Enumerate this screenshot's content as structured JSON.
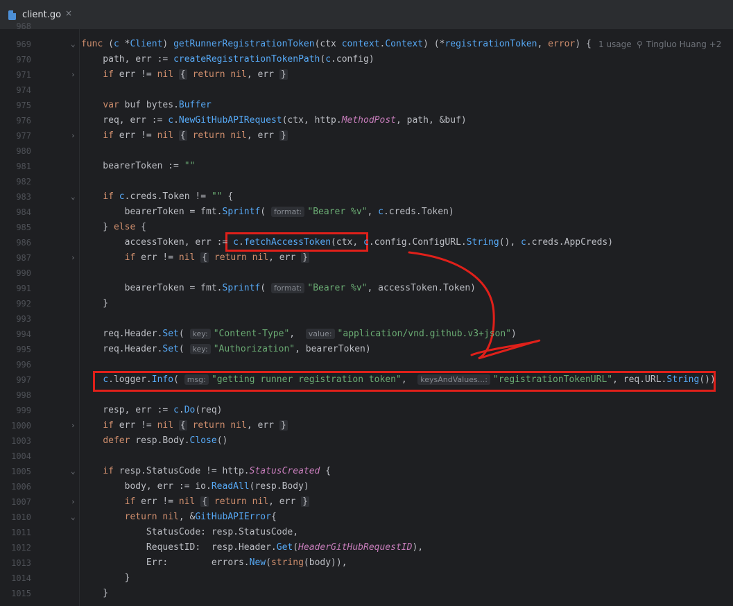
{
  "tab": {
    "filename": "client.go",
    "close_glyph": "×"
  },
  "header_hints": {
    "usages": "1 usage",
    "author": "Tingluo Huang +2"
  },
  "colors": {
    "highlight_box": "#e0201a",
    "keyword": "#cf8e6d",
    "string": "#6aab73",
    "function": "#56a8f5"
  },
  "lines": [
    {
      "n": "969",
      "fold": "v",
      "html": "<span class=\"kw\">func</span> (<span class=\"rc\">c</span> *<span class=\"ty\">Client</span>) <span class=\"fn\">getRunnerRegistrationToken</span>(ctx <span class=\"ty\">context</span>.<span class=\"ty\">Context</span>) (*<span class=\"ty\">registrationToken</span>, <span class=\"kw\">error</span>) {"
    },
    {
      "n": "970",
      "fold": "",
      "html": "    path, err := <span class=\"mt\">createRegistrationTokenPath</span>(<span class=\"rc\">c</span>.config)"
    },
    {
      "n": "971",
      "fold": ">",
      "html": "    <span class=\"kw\">if</span> err != <span class=\"kw\">nil</span> <span class=\"collapsed\">{</span> <span class=\"kw\">return</span> <span class=\"kw\">nil</span>, err <span class=\"collapsed\">}</span>"
    },
    {
      "n": "974",
      "fold": "",
      "html": ""
    },
    {
      "n": "975",
      "fold": "",
      "html": "    <span class=\"kw\">var</span> buf bytes.<span class=\"ty\">Buffer</span>"
    },
    {
      "n": "976",
      "fold": "",
      "html": "    req, err := <span class=\"rc\">c</span>.<span class=\"mt\">NewGitHubAPIRequest</span>(ctx, http.<span class=\"it\">MethodPost</span>, path, &amp;buf)"
    },
    {
      "n": "977",
      "fold": ">",
      "html": "    <span class=\"kw\">if</span> err != <span class=\"kw\">nil</span> <span class=\"collapsed\">{</span> <span class=\"kw\">return</span> <span class=\"kw\">nil</span>, err <span class=\"collapsed\">}</span>"
    },
    {
      "n": "980",
      "fold": "",
      "html": ""
    },
    {
      "n": "981",
      "fold": "",
      "html": "    bearerToken := <span class=\"st\">\"\"</span>"
    },
    {
      "n": "982",
      "fold": "",
      "html": ""
    },
    {
      "n": "983",
      "fold": "v",
      "html": "    <span class=\"kw\">if</span> <span class=\"rc\">c</span>.creds.Token != <span class=\"st\">\"\"</span> {"
    },
    {
      "n": "984",
      "fold": "",
      "html": "        bearerToken = fmt.<span class=\"mt\">Sprintf</span>( <span class=\"hint\">format:</span><span class=\"st\">\"Bearer %v\"</span>, <span class=\"rc\">c</span>.creds.Token)"
    },
    {
      "n": "985",
      "fold": "",
      "html": "    } <span class=\"kw\">else</span> {"
    },
    {
      "n": "986",
      "fold": "",
      "html": "        accessToken, err := <span class=\"rc\">c</span>.<span class=\"mt\">fetchAccessToken</span>(ctx, <span class=\"rc\">c</span>.config.ConfigURL.<span class=\"mt\">String</span>(), <span class=\"rc\">c</span>.creds.AppCreds)"
    },
    {
      "n": "987",
      "fold": ">",
      "html": "        <span class=\"kw\">if</span> err != <span class=\"kw\">nil</span> <span class=\"collapsed\">{</span> <span class=\"kw\">return</span> <span class=\"kw\">nil</span>, err <span class=\"collapsed\">}</span>"
    },
    {
      "n": "990",
      "fold": "",
      "html": ""
    },
    {
      "n": "991",
      "fold": "",
      "html": "        bearerToken = fmt.<span class=\"mt\">Sprintf</span>( <span class=\"hint\">format:</span><span class=\"st\">\"Bearer %v\"</span>, accessToken.Token)"
    },
    {
      "n": "992",
      "fold": "",
      "html": "    }"
    },
    {
      "n": "993",
      "fold": "",
      "html": ""
    },
    {
      "n": "994",
      "fold": "",
      "html": "    req.Header.<span class=\"mt\">Set</span>( <span class=\"hint\">key:</span><span class=\"st\">\"Content-Type\"</span>,  <span class=\"hint\">value:</span><span class=\"st\">\"application/vnd.github.v3+json\"</span>)"
    },
    {
      "n": "995",
      "fold": "",
      "html": "    req.Header.<span class=\"mt\">Set</span>( <span class=\"hint\">key:</span><span class=\"st\">\"Authorization\"</span>, bearerToken)"
    },
    {
      "n": "996",
      "fold": "",
      "html": ""
    },
    {
      "n": "997",
      "fold": "",
      "html": "    <span class=\"rc\">c</span>.logger.<span class=\"mt\">Info</span>( <span class=\"hint\">msg:</span><span class=\"st\">\"getting runner registration token\"</span>,  <span class=\"hint\">keysAndValues...:</span><span class=\"st\">\"registrationTokenURL\"</span>, req.URL.<span class=\"mt\">String</span>())"
    },
    {
      "n": "998",
      "fold": "",
      "html": ""
    },
    {
      "n": "999",
      "fold": "",
      "html": "    resp, err := <span class=\"rc\">c</span>.<span class=\"mt\">Do</span>(req)"
    },
    {
      "n": "1000",
      "fold": ">",
      "html": "    <span class=\"kw\">if</span> err != <span class=\"kw\">nil</span> <span class=\"collapsed\">{</span> <span class=\"kw\">return</span> <span class=\"kw\">nil</span>, err <span class=\"collapsed\">}</span>"
    },
    {
      "n": "1003",
      "fold": "",
      "html": "    <span class=\"kw\">defer</span> resp.Body.<span class=\"mt\">Close</span>()"
    },
    {
      "n": "1004",
      "fold": "",
      "html": ""
    },
    {
      "n": "1005",
      "fold": "v",
      "html": "    <span class=\"kw\">if</span> resp.StatusCode != http.<span class=\"cn\">StatusCreated</span> {"
    },
    {
      "n": "1006",
      "fold": "",
      "html": "        body, err := io.<span class=\"mt\">ReadAll</span>(resp.Body)"
    },
    {
      "n": "1007",
      "fold": ">",
      "html": "        <span class=\"kw\">if</span> err != <span class=\"kw\">nil</span> <span class=\"collapsed\">{</span> <span class=\"kw\">return</span> <span class=\"kw\">nil</span>, err <span class=\"collapsed\">}</span>"
    },
    {
      "n": "1010",
      "fold": "v",
      "html": "        <span class=\"kw\">return</span> <span class=\"kw\">nil</span>, &amp;<span class=\"ty\">GitHubAPIError</span>{"
    },
    {
      "n": "1011",
      "fold": "",
      "html": "            StatusCode: resp.StatusCode,"
    },
    {
      "n": "1012",
      "fold": "",
      "html": "            RequestID:  resp.Header.<span class=\"mt\">Get</span>(<span class=\"cn\">HeaderGitHubRequestID</span>),"
    },
    {
      "n": "1013",
      "fold": "",
      "html": "            Err:        errors.<span class=\"mt\">New</span>(<span class=\"kw\">string</span>(body)),"
    },
    {
      "n": "1014",
      "fold": "",
      "html": "        }"
    },
    {
      "n": "1015",
      "fold": "",
      "html": "    }"
    }
  ]
}
